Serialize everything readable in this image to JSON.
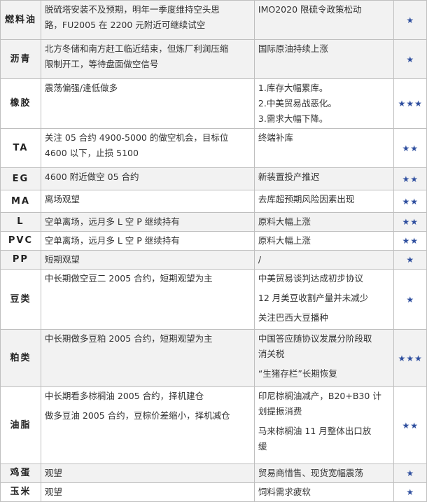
{
  "rows": [
    {
      "name": "燃料油",
      "view": [
        "脱硫塔安装不及预期，明年一季度维持空头思",
        "路，FU2005 在 2200 元附近可继续试空"
      ],
      "reason": [
        "IMO2020 限硫令政策松动"
      ],
      "stars": "★"
    },
    {
      "name": "沥青",
      "view": [
        "北方冬储和南方赶工临近结束，但炼厂利润压缩",
        "限制开工，等待盘面做空信号"
      ],
      "reason": [
        "国际原油持续上涨"
      ],
      "stars": "★"
    },
    {
      "name": "橡胶",
      "view": [
        "震荡偏强/逢低做多"
      ],
      "reason": [
        "1.库存大幅累库。",
        "2.中美贸易战恶化。",
        "3.需求大幅下降。"
      ],
      "stars": "★★★"
    },
    {
      "name": "TA",
      "view": [
        "关注 05 合约 4900-5000 的做空机会，目标位",
        "4600 以下，止损 5100"
      ],
      "reason": [
        "终端补库"
      ],
      "stars": "★★"
    },
    {
      "name": "EG",
      "view": [
        "4600 附近做空 05 合约"
      ],
      "reason": [
        "新装置投产推迟"
      ],
      "stars": "★★"
    },
    {
      "name": "MA",
      "view": [
        "离场观望"
      ],
      "reason": [
        "去库超预期风险因素出现"
      ],
      "stars": "★★"
    },
    {
      "name": "L",
      "view": [
        "空单离场，远月多 L 空 P 继续持有"
      ],
      "reason": [
        "原料大幅上涨"
      ],
      "stars": "★★"
    },
    {
      "name": "PVC",
      "view": [
        "空单离场，远月多 L 空 P 继续持有"
      ],
      "reason": [
        "原料大幅上涨"
      ],
      "stars": "★★"
    },
    {
      "name": "PP",
      "view": [
        "短期观望"
      ],
      "reason": [
        "/"
      ],
      "stars": "★"
    },
    {
      "name": "豆类",
      "view": [
        "中长期做空豆二 2005 合约，短期观望为主"
      ],
      "reason": [
        "中美贸易谈判达成初步协议",
        "12 月美豆收割产量并未减少",
        "关注巴西大豆播种"
      ],
      "stars": "★"
    },
    {
      "name": "粕类",
      "view": [
        "中长期做多豆粕 2005 合约，短期观望为主"
      ],
      "reason": [
        "中国答应随协议发展分阶段取",
        "消关税",
        "“生猪存栏”长期恢复"
      ],
      "stars": "★★★"
    },
    {
      "name": "油脂",
      "view": [
        "中长期看多棕榈油 2005 合约，择机建仓",
        "做多豆油 2005 合约，豆棕价差缩小，择机减仓"
      ],
      "reason": [
        "印尼棕榈油减产，B20+B30 计",
        "划提振消费",
        "马来棕榈油 11 月整体出口放",
        "缓"
      ],
      "stars": "★★"
    },
    {
      "name": "鸡蛋",
      "view": [
        "观望"
      ],
      "reason": [
        "贸易商惜售、现货宽幅震荡"
      ],
      "stars": "★"
    },
    {
      "name": "玉米",
      "view": [
        "观望"
      ],
      "reason": [
        "饲料需求疲软"
      ],
      "stars": "★"
    }
  ],
  "colors": {
    "star": "#2f4f9f",
    "shade": "#f2f2f2",
    "border": "#bfbfbf"
  }
}
